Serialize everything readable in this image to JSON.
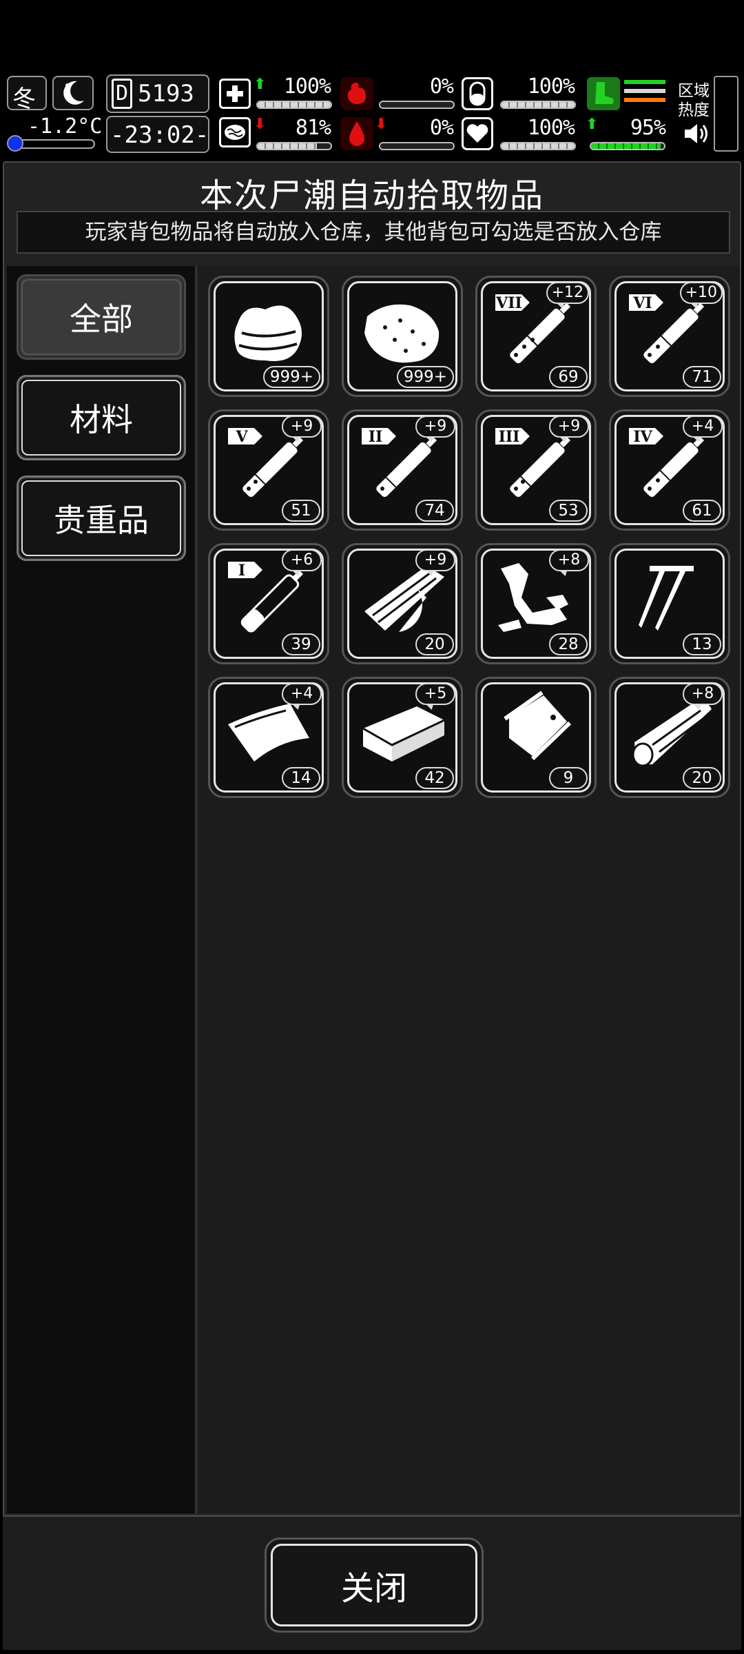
{
  "status": {
    "season": "冬",
    "temperature": "-1.2°C",
    "day": "5193",
    "time": "-23:02-",
    "stats": {
      "health": "100%",
      "stomach": "0%",
      "stamina": "100%",
      "brain": "81%",
      "blood": "0%",
      "heart": "100%",
      "leg": "95%"
    },
    "stat_levels": {
      "health": 1.0,
      "stomach": 0.0,
      "stamina": 1.0,
      "brain": 0.81,
      "blood": 0.0,
      "heart": 1.0,
      "leg": 0.95
    },
    "region_heat_label": "区域热度"
  },
  "dialog": {
    "title": "本次尸潮自动拾取物品",
    "subtitle": "玩家背包物品将自动放入仓库，其他背包可勾选是否放入仓库"
  },
  "categories": [
    {
      "label": "全部",
      "active": true
    },
    {
      "label": "材料",
      "active": false
    },
    {
      "label": "贵重品",
      "active": false
    }
  ],
  "items": [
    {
      "icon": "cloth-icon",
      "count": "999+",
      "plus": ""
    },
    {
      "icon": "meat-icon",
      "count": "999+",
      "plus": ""
    },
    {
      "icon": "syringe-vii-icon",
      "tier": "VII",
      "count": "69",
      "plus": "+12"
    },
    {
      "icon": "syringe-vi-icon",
      "tier": "VI",
      "count": "71",
      "plus": "+10"
    },
    {
      "icon": "syringe-v-icon",
      "tier": "V",
      "count": "51",
      "plus": "+9"
    },
    {
      "icon": "syringe-ii-icon",
      "tier": "II",
      "count": "74",
      "plus": "+9"
    },
    {
      "icon": "syringe-iii-icon",
      "tier": "III",
      "count": "53",
      "plus": "+9"
    },
    {
      "icon": "syringe-iv-icon",
      "tier": "IV",
      "count": "61",
      "plus": "+4"
    },
    {
      "icon": "syringe-i-icon",
      "tier": "I",
      "count": "39",
      "plus": "+6"
    },
    {
      "icon": "wood-planks-icon",
      "count": "20",
      "plus": "+9"
    },
    {
      "icon": "scrap-metal-icon",
      "count": "28",
      "plus": "+8"
    },
    {
      "icon": "nails-icon",
      "count": "13",
      "plus": ""
    },
    {
      "icon": "plastic-sheet-icon",
      "count": "14",
      "plus": "+4"
    },
    {
      "icon": "brick-icon",
      "count": "42",
      "plus": "+5"
    },
    {
      "icon": "bag-icon",
      "count": "9",
      "plus": ""
    },
    {
      "icon": "log-icon",
      "count": "20",
      "plus": "+8"
    }
  ],
  "close_label": "关闭",
  "colors": {
    "accent_green": "#22d322",
    "alert_red": "#e01010",
    "panel_bg": "#222222"
  }
}
